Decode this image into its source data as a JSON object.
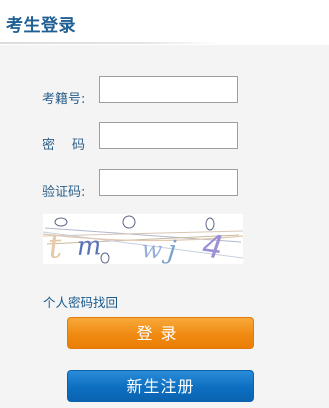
{
  "header": {
    "title": "考生登录"
  },
  "form": {
    "exam_id_label": "考籍号:",
    "exam_id_value": "",
    "password_label": "密码:",
    "password_value": "",
    "captcha_label": "验证码:",
    "captcha_value": ""
  },
  "captcha": {
    "chars": [
      "t",
      "m",
      "w",
      "j",
      "4"
    ],
    "colors": [
      "#e8c9a8",
      "#5a72b8",
      "#9ab0dc",
      "#7aa0cc",
      "#9b8fd6"
    ]
  },
  "links": {
    "forgot_password": "个人密码找回"
  },
  "buttons": {
    "login": "登录",
    "register": "新生注册"
  },
  "colors": {
    "title": "#1f5f94",
    "label": "#2c5f8a",
    "login_button": "#f08a12",
    "register_button": "#0d6fc1"
  }
}
